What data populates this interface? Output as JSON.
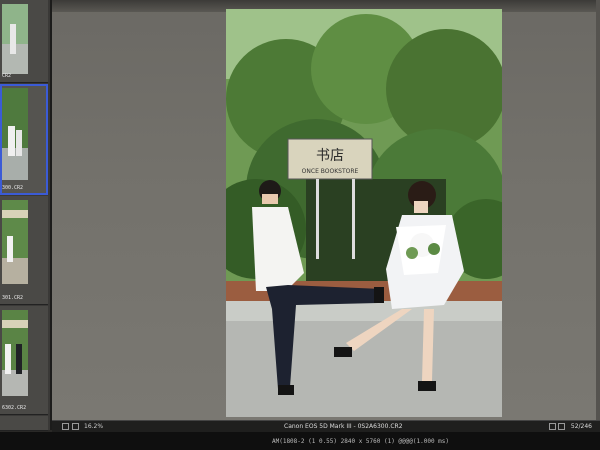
{
  "filmstrip": {
    "thumbs": [
      {
        "name": "CR2"
      },
      {
        "name": "300.CR2"
      },
      {
        "name": "301.CR2"
      },
      {
        "name": "6302.CR2"
      }
    ]
  },
  "photo": {
    "sign_text": "书店",
    "sign_sub": "ONCE BOOKSTORE"
  },
  "statusbar": {
    "zoom": "16.2%",
    "caption": "Canon EOS 5D Mark III  -  0S2A6300.CR2",
    "counter": "52/246"
  },
  "infobar": {
    "text": "AM(1808-2 (1 0.55)  2840 x 5760  (1)  @@@@(1.000 ms)"
  }
}
